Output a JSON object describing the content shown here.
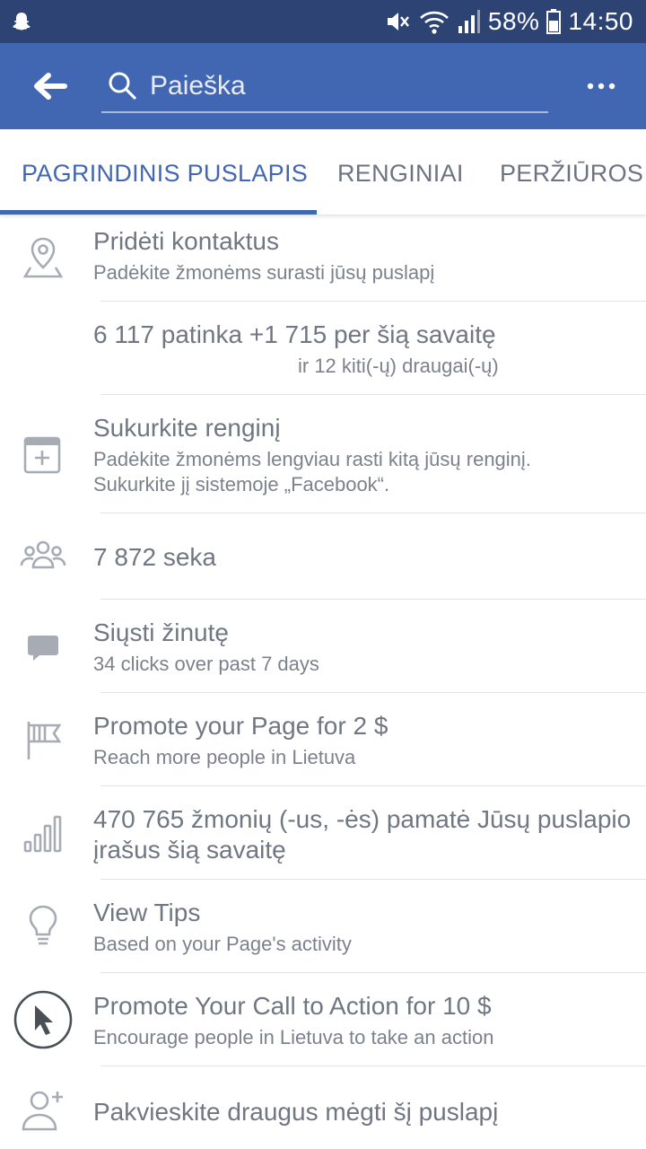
{
  "status_bar": {
    "battery_percent": "58%",
    "time": "14:50"
  },
  "header": {
    "search_placeholder": "Paieška"
  },
  "tabs": [
    {
      "label": "PAGRINDINIS PUSLAPIS",
      "active": true
    },
    {
      "label": "RENGINIAI",
      "active": false
    },
    {
      "label": "PERŽIŪROS",
      "active": false
    }
  ],
  "rows": {
    "contacts": {
      "title": "Pridėti kontaktus",
      "subtitle": "Padėkite žmonėms surasti jūsų puslapį",
      "icon": "location-pin-icon"
    },
    "likes": {
      "title": "6 117 patinka +1 715 per šią savaitę",
      "subtitle": "ir 12 kiti(-ų) draugai(-ų)"
    },
    "event": {
      "title": "Sukurkite renginį",
      "subtitle_line1": "Padėkite žmonėms lengviau rasti kitą jūsų renginį.",
      "subtitle_line2": "Sukurkite jį sistemoje „Facebook“.",
      "icon": "calendar-add-icon"
    },
    "followers": {
      "title": "7 872 seka",
      "icon": "people-icon"
    },
    "message": {
      "title": "Siųsti žinutę",
      "subtitle": "34 clicks over past 7 days",
      "icon": "message-icon"
    },
    "promote_page": {
      "title": "Promote your Page for 2 $",
      "subtitle": "Reach more people in Lietuva",
      "icon": "flag-icon"
    },
    "reach": {
      "title_line1": "470 765 žmonių (-us, -ės) pamatė Jūsų puslapio",
      "title_line2": "įrašus šią savaitę",
      "icon": "bar-chart-icon"
    },
    "tips": {
      "title": "View Tips",
      "subtitle": "Based on your Page's activity",
      "icon": "lightbulb-icon"
    },
    "cta": {
      "title": "Promote Your Call to Action for 10 $",
      "subtitle": "Encourage people in Lietuva to take an action",
      "icon": "cursor-icon"
    },
    "invite": {
      "title": "Pakvieskite draugus mėgti šį puslapį",
      "icon": "add-person-icon"
    }
  },
  "colors": {
    "status_bar": "#2d4373",
    "header": "#4267b2",
    "accent": "#4267b2",
    "text_gray": "#707682"
  }
}
